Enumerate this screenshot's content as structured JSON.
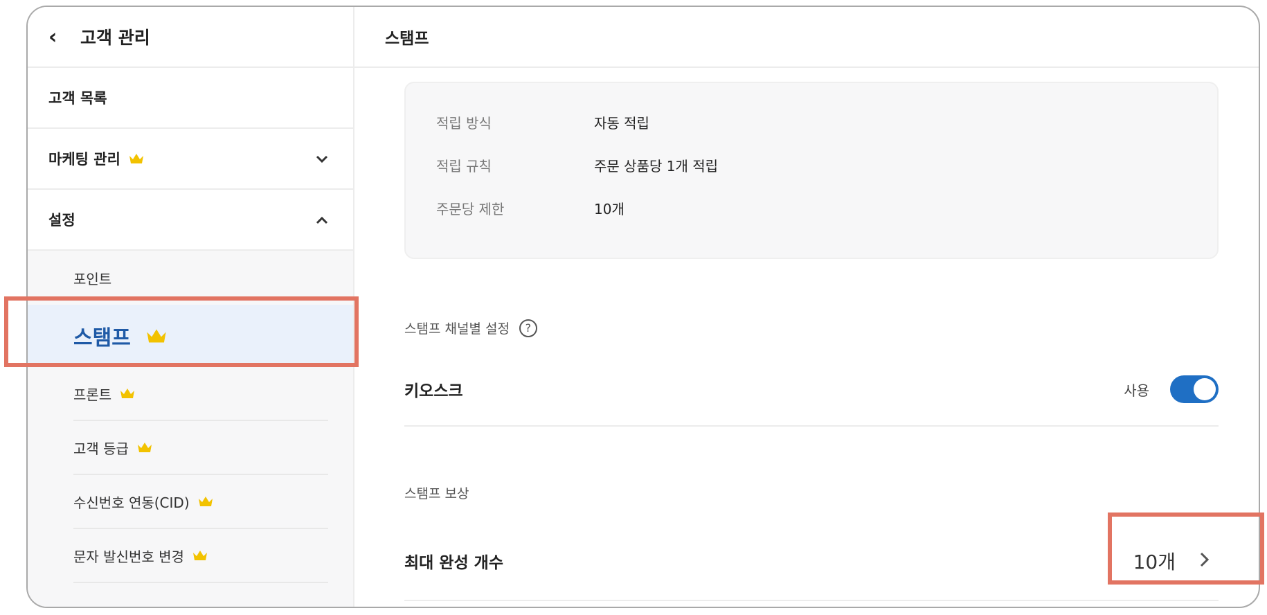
{
  "sidebar": {
    "back_icon": "chevron-left-icon",
    "title": "고객 관리",
    "items": [
      {
        "label": "고객 목록"
      },
      {
        "label": "마케팅 관리",
        "premium": true,
        "chevron": "chevron-down-icon"
      },
      {
        "label": "설정",
        "chevron": "chevron-up-icon"
      }
    ],
    "settings_children": [
      {
        "label": "포인트"
      },
      {
        "label": "스탬프",
        "premium": true,
        "active": true
      },
      {
        "label": "프론트",
        "premium": true
      },
      {
        "label": "고객 등급",
        "premium": true
      },
      {
        "label": "수신번호 연동(CID)",
        "premium": true
      },
      {
        "label": "문자 발신번호 변경",
        "premium": true
      }
    ],
    "crown_color": "#f2c200",
    "active_color": "#1f5aa6"
  },
  "main": {
    "title": "스탬프",
    "info": [
      {
        "label": "적립 방식",
        "value": "자동 적립"
      },
      {
        "label": "적립 규칙",
        "value": "주문 상품당 1개 적립"
      },
      {
        "label": "주문당 제한",
        "value": "10개"
      }
    ],
    "channel_section": {
      "label": "스탬프 채널별 설정",
      "help_icon": "question-circle-icon"
    },
    "kiosk": {
      "name": "키오스크",
      "toggle_label": "사용",
      "enabled": true
    },
    "reward_section": {
      "label": "스탬프 보상"
    },
    "max_complete": {
      "name": "최대 완성 개수",
      "value": "10개",
      "arrow_icon": "chevron-right-icon"
    }
  },
  "highlight_color": "#e27462",
  "toggle_color": "#1f6fc4"
}
